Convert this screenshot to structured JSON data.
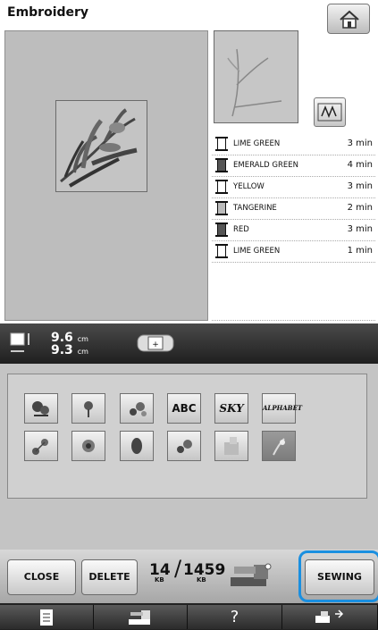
{
  "header": {
    "title": "Embroidery"
  },
  "threads": [
    {
      "name": "LIME GREEN",
      "minutes": "3 min",
      "color": "#ffffff"
    },
    {
      "name": "EMERALD GREEN",
      "minutes": "4 min",
      "color": "#555555"
    },
    {
      "name": "YELLOW",
      "minutes": "3 min",
      "color": "#ffffff"
    },
    {
      "name": "TANGERINE",
      "minutes": "2 min",
      "color": "#bbbbbb"
    },
    {
      "name": "RED",
      "minutes": "3 min",
      "color": "#555555"
    },
    {
      "name": "LIME GREEN",
      "minutes": "1 min",
      "color": "#ffffff"
    }
  ],
  "size": {
    "width_value": "9.6",
    "height_value": "9.3",
    "unit": "cm"
  },
  "patterns": {
    "row1": [
      {
        "icon": "flower-pattern-icon"
      },
      {
        "icon": "flower-pattern-icon"
      },
      {
        "icon": "flower-pattern-icon"
      },
      {
        "text": "ABC"
      },
      {
        "text": "SKY"
      },
      {
        "text": "ALPHABET"
      }
    ],
    "row2": [
      {
        "icon": "flower-pattern-icon"
      },
      {
        "icon": "flower-pattern-icon"
      },
      {
        "icon": "flower-pattern-icon"
      },
      {
        "icon": "flower-pattern-icon"
      },
      {
        "icon": "flower-pattern-icon"
      },
      {
        "icon": "flower-pattern-icon"
      }
    ]
  },
  "buttons": {
    "close": "CLOSE",
    "delete": "DELETE",
    "sewing": "SEWING"
  },
  "memory": {
    "used": "14",
    "total": "1459",
    "used_unit": "KB",
    "total_unit": "KB"
  },
  "nav": {
    "help": "?"
  }
}
